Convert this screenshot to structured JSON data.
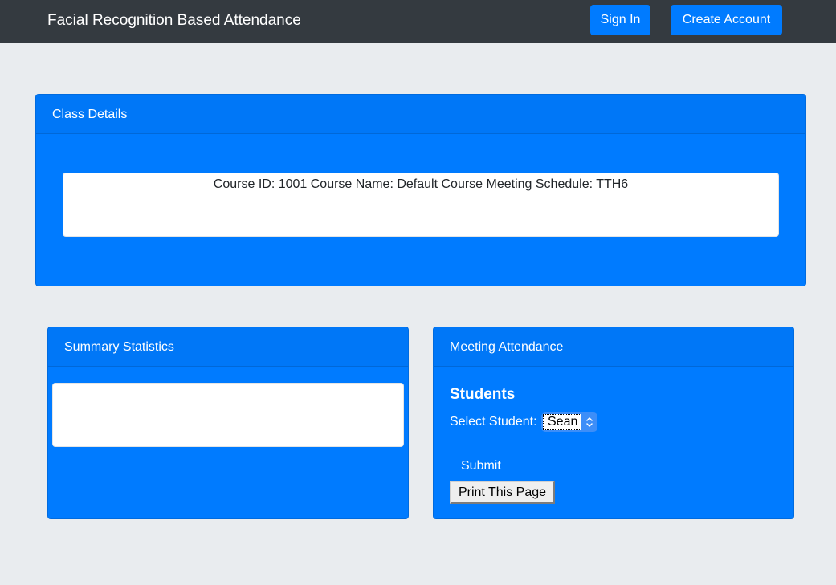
{
  "navbar": {
    "brand": "Facial Recognition Based Attendance",
    "sign_in_label": "Sign In",
    "create_account_label": "Create Account"
  },
  "class_details": {
    "title": "Class Details",
    "info": "Course ID: 1001 Course Name: Default Course Meeting Schedule: TTH6"
  },
  "summary_statistics": {
    "title": "Summary Statistics"
  },
  "meeting_attendance": {
    "title": "Meeting Attendance",
    "students_heading": "Students",
    "select_label": "Select Student:",
    "selected_student": "Sean",
    "submit_label": "Submit",
    "print_label": "Print This Page"
  },
  "colors": {
    "navbar_bg": "#343a40",
    "primary": "#007bff",
    "page_bg": "#e9ecef"
  }
}
